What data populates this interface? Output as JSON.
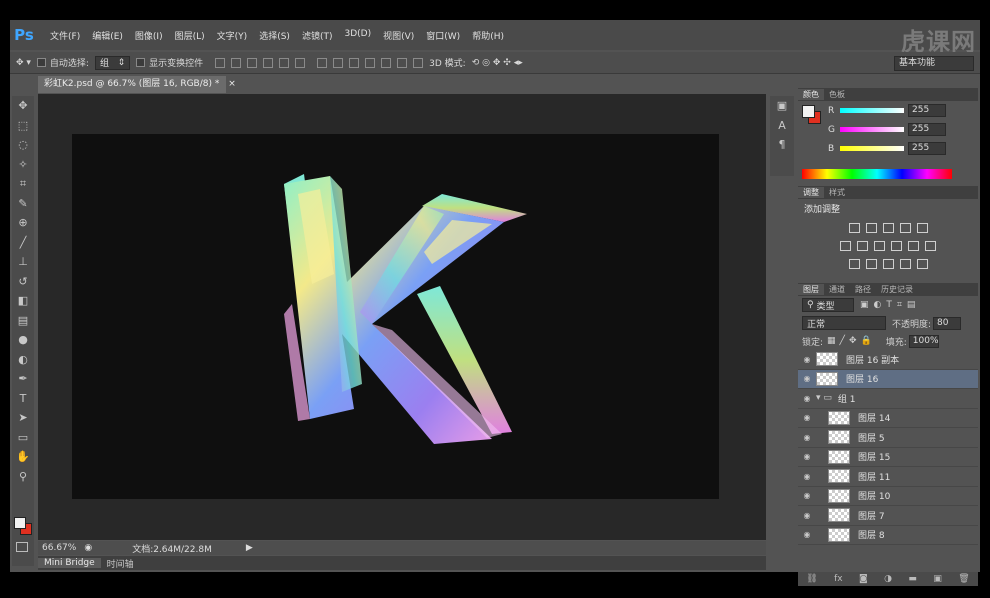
{
  "app": {
    "logo": "Ps",
    "watermark": "虎课网"
  },
  "menus": [
    "文件(F)",
    "编辑(E)",
    "图像(I)",
    "图层(L)",
    "文字(Y)",
    "选择(S)",
    "滤镜(T)",
    "3D(D)",
    "视图(V)",
    "窗口(W)",
    "帮助(H)"
  ],
  "options": {
    "auto_select_label": "自动选择:",
    "auto_select_value": "组",
    "show_transform_label": "显示变换控件",
    "mode_3d_label": "3D 模式:",
    "workspace": "基本功能"
  },
  "document": {
    "tab_title": "彩虹K2.psd @ 66.7% (图层 16, RGB/8) *",
    "close": "×"
  },
  "status": {
    "zoom": "66.67%",
    "doc_info": "文档:2.64M/22.8M"
  },
  "bottom_tabs": [
    "Mini Bridge",
    "时间轴"
  ],
  "color_panel": {
    "tabs": [
      "颜色",
      "色板"
    ],
    "r_label": "R",
    "r_value": "255",
    "g_label": "G",
    "g_value": "255",
    "b_label": "B",
    "b_value": "255"
  },
  "adjust_panel": {
    "tabs": [
      "调整",
      "样式"
    ],
    "title": "添加调整"
  },
  "layers_panel": {
    "tabs": [
      "图层",
      "通道",
      "路径",
      "历史记录"
    ],
    "filter_label": "类型",
    "blend_mode": "正常",
    "opacity_label": "不透明度:",
    "opacity_value": "80",
    "lock_label": "锁定:",
    "fill_label": "填充:",
    "fill_value": "100%",
    "layers": [
      {
        "name": "图层 16 副本",
        "indent": false,
        "selected": false,
        "group": false
      },
      {
        "name": "图层 16",
        "indent": false,
        "selected": true,
        "group": false
      },
      {
        "name": "组 1",
        "indent": false,
        "selected": false,
        "group": true
      },
      {
        "name": "图层 14",
        "indent": true,
        "selected": false,
        "group": false
      },
      {
        "name": "图层 5",
        "indent": true,
        "selected": false,
        "group": false
      },
      {
        "name": "图层 15",
        "indent": true,
        "selected": false,
        "group": false
      },
      {
        "name": "图层 11",
        "indent": true,
        "selected": false,
        "group": false
      },
      {
        "name": "图层 10",
        "indent": true,
        "selected": false,
        "group": false
      },
      {
        "name": "图层 7",
        "indent": true,
        "selected": false,
        "group": false
      },
      {
        "name": "图层 8",
        "indent": true,
        "selected": false,
        "group": false
      }
    ]
  },
  "colors": {
    "accent_blue": "#3fa6ff",
    "foreground": "#f2f2f2",
    "background": "#e03020",
    "selected_layer": "#5f6e84"
  }
}
